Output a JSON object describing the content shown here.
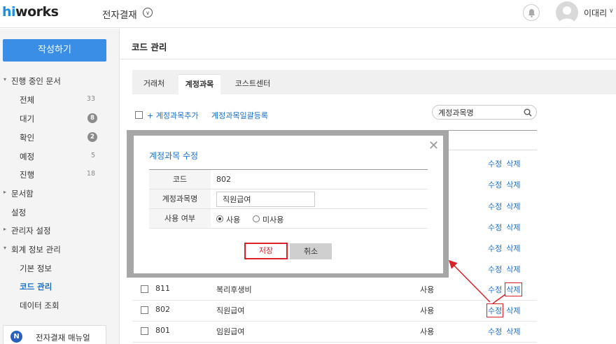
{
  "header": {
    "logo": "works",
    "logo_hi": "hi",
    "app_title": "전자결재",
    "user_name": "이대리"
  },
  "sidebar": {
    "compose_label": "작성하기",
    "items": [
      {
        "label": "진행 중인 문서",
        "type": "group-open"
      },
      {
        "label": "전체",
        "count": "33"
      },
      {
        "label": "대기",
        "badge": "8"
      },
      {
        "label": "확인",
        "badge": "2"
      },
      {
        "label": "예정",
        "count": "5"
      },
      {
        "label": "진행",
        "count": "18"
      },
      {
        "label": "문서함",
        "type": "group-closed"
      },
      {
        "label": "설정",
        "type": "plain"
      },
      {
        "label": "관리자 설정",
        "type": "group-closed"
      },
      {
        "label": "회계 정보 관리",
        "type": "group-open"
      },
      {
        "label": "기본 정보"
      },
      {
        "label": "코드 관리",
        "active": true
      },
      {
        "label": "데이터 조회"
      }
    ],
    "manual_icon": "N",
    "manual_label": "전자결재 매뉴얼"
  },
  "main": {
    "title": "코드 관리",
    "tabs": [
      "거래처",
      "계정과목",
      "코스트센터"
    ],
    "active_tab": "계정과목",
    "toolbar": {
      "add_label": "+ 계정과목추가",
      "bulk_label": "계정과목일괄등록"
    },
    "search": {
      "value": "계정과목명"
    },
    "ghost_rows": {
      "code": "811",
      "name": "복리후생비",
      "use": "사용"
    },
    "row_action_edit": "수정",
    "row_action_delete": "삭제",
    "rows": [
      {
        "code": "811",
        "name": "복리후생비",
        "use": "사용"
      },
      {
        "code": "802",
        "name": "직원급여",
        "use": "사용"
      },
      {
        "code": "801",
        "name": "임원급여",
        "use": "사용"
      }
    ]
  },
  "modal": {
    "title": "계정과목 수정",
    "code_label": "코드",
    "code_value": "802",
    "name_label": "계정과목명",
    "name_value": "직원급여",
    "use_label": "사용 여부",
    "use_option_on": "사용",
    "use_option_off": "미사용",
    "save_label": "저장",
    "cancel_label": "취소"
  },
  "colors": {
    "accent": "#3a8ee6",
    "link": "#1a6fc9",
    "highlight": "#d9232c"
  }
}
